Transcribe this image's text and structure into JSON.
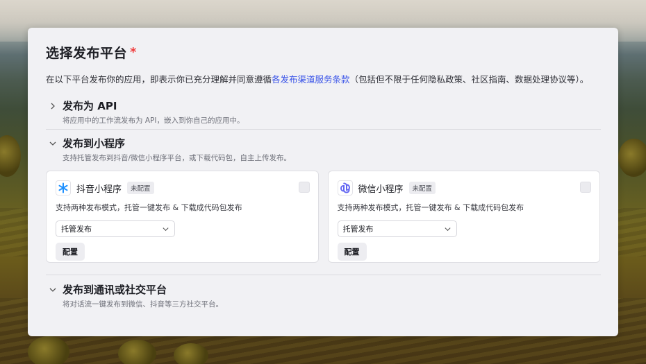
{
  "page": {
    "title": "选择发布平台",
    "required_mark": "*",
    "intro_prefix": "在以下平台发布你的应用，即表示你已充分理解并同意遵循",
    "intro_link": "各发布渠道服务条款",
    "intro_suffix": "（包括但不限于任何隐私政策、社区指南、数据处理协议等）。"
  },
  "sections": [
    {
      "title": "发布为 API",
      "desc": "将应用中的工作流发布为 API，嵌入到你自己的应用中。",
      "expanded": false
    },
    {
      "title": "发布到小程序",
      "desc": "支持托管发布到抖音/微信小程序平台，或下载代码包，自主上传发布。",
      "expanded": true,
      "platforms": [
        {
          "name": "抖音小程序",
          "badge": "未配置",
          "icon": "douyin-miniapp-icon",
          "desc": "支持两种发布模式，托管一键发布 & 下载成代码包发布",
          "select_value": "托管发布",
          "config_label": "配置",
          "accent": "#1e90ff"
        },
        {
          "name": "微信小程序",
          "badge": "未配置",
          "icon": "wechat-miniapp-icon",
          "desc": "支持两种发布模式，托管一键发布 & 下载成代码包发布",
          "select_value": "托管发布",
          "config_label": "配置",
          "accent": "#6467f2"
        }
      ]
    },
    {
      "title": "发布到通讯或社交平台",
      "desc": "将对话流一键发布到微信、抖音等三方社交平台。",
      "expanded": true
    }
  ]
}
